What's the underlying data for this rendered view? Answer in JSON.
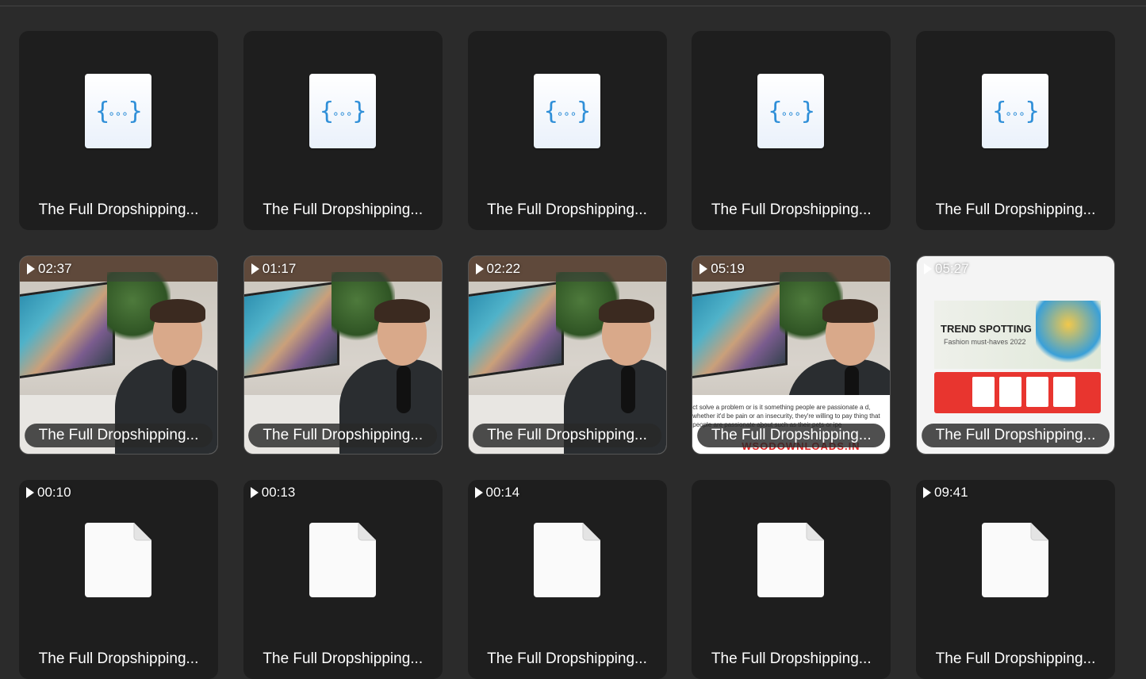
{
  "items": [
    {
      "kind": "json",
      "label": "The Full Dropshipping..."
    },
    {
      "kind": "json",
      "label": "The Full Dropshipping..."
    },
    {
      "kind": "json",
      "label": "The Full Dropshipping..."
    },
    {
      "kind": "json",
      "label": "The Full Dropshipping..."
    },
    {
      "kind": "json",
      "label": "The Full Dropshipping..."
    },
    {
      "kind": "video",
      "duration": "02:37",
      "label": "The Full Dropshipping..."
    },
    {
      "kind": "video",
      "duration": "01:17",
      "label": "The Full Dropshipping..."
    },
    {
      "kind": "video",
      "duration": "02:22",
      "label": "The Full Dropshipping..."
    },
    {
      "kind": "video-text",
      "duration": "05:19",
      "label": "The Full Dropshipping...",
      "subtitle_text": "ct solve a problem or is it something people are passionate a d, whether it'd be pain or an insecurity, they're willing to pay thing that people are passionate about such as their pets or ipe",
      "watermark": "WSODOWNLOADS.IN"
    },
    {
      "kind": "video-shop",
      "duration": "05:27",
      "label": "The Full Dropshipping...",
      "shop_title": "TREND SPOTTING",
      "shop_sub": "Fashion must-haves 2022"
    },
    {
      "kind": "doc",
      "duration": "00:10",
      "label": "The Full Dropshipping..."
    },
    {
      "kind": "doc",
      "duration": "00:13",
      "label": "The Full Dropshipping..."
    },
    {
      "kind": "doc",
      "duration": "00:14",
      "label": "The Full Dropshipping..."
    },
    {
      "kind": "doc",
      "label": "The Full Dropshipping..."
    },
    {
      "kind": "doc",
      "duration": "09:41",
      "label": "The Full Dropshipping..."
    }
  ],
  "colors": {
    "background": "#2b2b2b",
    "card": "#1e1e1e",
    "json_brace": "#2f8fd8",
    "watermark": "#dd2222"
  }
}
